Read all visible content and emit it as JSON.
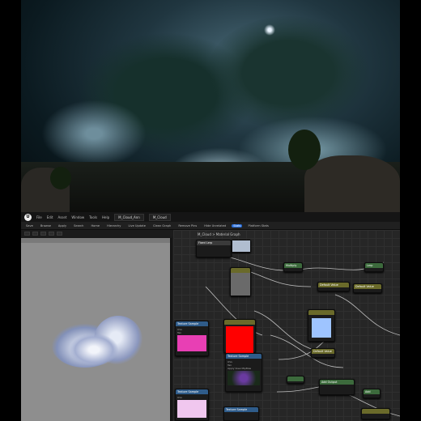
{
  "editor": {
    "logo": "U",
    "menus": [
      "File",
      "Edit",
      "Asset",
      "Window",
      "Tools",
      "Help"
    ],
    "tabs": [
      "M_Cloud_Ann",
      "M_Cloud"
    ],
    "toolbar": [
      "Save",
      "Browse",
      "Apply",
      "Search",
      "Home",
      "Hierarchy",
      "Live Update",
      "Clean Graph",
      "Remove Pins",
      "Hide Unrelated",
      "Stats",
      "Platform Stats"
    ],
    "active_toolbar": "Stats",
    "graph_title": "M_Cloud > Material Graph"
  },
  "nodes": [
    {
      "id": "n1",
      "title": "Fixed Lerp",
      "pins": [
        "A",
        "B",
        "Alpha"
      ]
    },
    {
      "id": "n2",
      "title": "Texture Sample",
      "pins": [
        "UVs",
        "Tex",
        "Apply View MipBias"
      ]
    },
    {
      "id": "n3",
      "title": "Texture Sample",
      "pins": [
        "UVs",
        "Tex",
        "Apply View MipBias"
      ]
    },
    {
      "id": "n4",
      "title": "Texture Sample",
      "pins": [
        "UVs",
        "Tex",
        "Apply View MipBias"
      ]
    },
    {
      "id": "n5",
      "title": "Texture Sample",
      "pins": [
        "UVs",
        "Tex",
        "Apply View MipBias"
      ]
    },
    {
      "id": "n6",
      "title": "Multiply",
      "pins": [
        "A",
        "B"
      ]
    },
    {
      "id": "n7",
      "title": "Default Value",
      "pins": []
    },
    {
      "id": "n8",
      "title": "Add",
      "pins": [
        "A",
        "B"
      ]
    },
    {
      "id": "n9",
      "title": "Lerp",
      "pins": [
        "A",
        "B",
        "Alpha"
      ]
    },
    {
      "id": "n10",
      "title": "Default Value",
      "pins": []
    },
    {
      "id": "n11",
      "title": "Add Output",
      "pins": []
    },
    {
      "id": "n12",
      "title": "Default Value",
      "pins": []
    }
  ],
  "colors": {
    "red_swatch": "#ff0000",
    "pink_swatch": "#e83fb4",
    "light_pink_swatch": "#f0c7ef",
    "blue_swatch": "#9ec4ff",
    "gray_swatch": "#6a6a6a",
    "accent": "#2a6fdb"
  }
}
